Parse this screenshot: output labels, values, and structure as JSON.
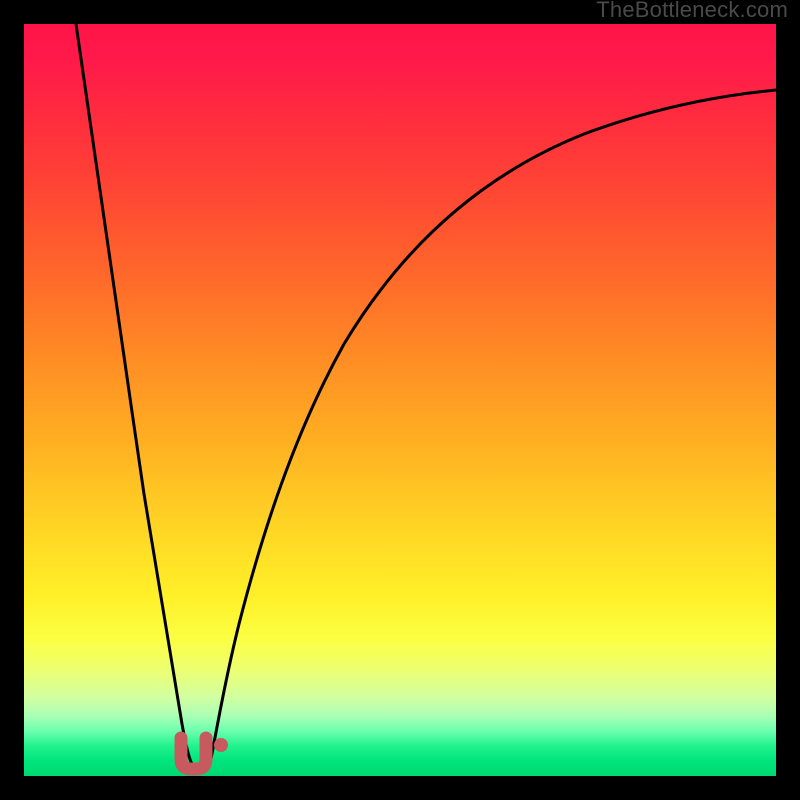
{
  "watermark": "TheBottleneck.com",
  "colors": {
    "frame": "#000000",
    "curve": "#000000",
    "marker": "#c65a5f",
    "watermark": "#4a4a4a"
  },
  "chart_data": {
    "type": "line",
    "title": "",
    "xlabel": "",
    "ylabel": "",
    "xlim": [
      0,
      100
    ],
    "ylim": [
      0,
      100
    ],
    "grid": false,
    "legend": false,
    "note": "Axes have no printed tick labels; values inferred as percentage scale 0-100. Two curves (left steep descent, right asymptotic rise) meeting at a minimum ≈ x=21 where a thick red marker sits.",
    "series": [
      {
        "name": "left_branch",
        "x": [
          7,
          8,
          10,
          12,
          14,
          16,
          18,
          20,
          21
        ],
        "values": [
          100,
          90,
          72,
          56,
          42,
          30,
          18,
          7,
          2
        ]
      },
      {
        "name": "right_branch",
        "x": [
          23,
          25,
          28,
          32,
          38,
          46,
          56,
          70,
          85,
          100
        ],
        "values": [
          2,
          10,
          22,
          36,
          50,
          62,
          72,
          80,
          85,
          88
        ]
      }
    ],
    "markers": [
      {
        "name": "min_marker_u",
        "shape": "u",
        "x": 21,
        "y": 2,
        "color": "#c65a5f"
      },
      {
        "name": "min_marker_dot",
        "shape": "dot",
        "x": 24.5,
        "y": 4,
        "color": "#c65a5f"
      }
    ]
  }
}
